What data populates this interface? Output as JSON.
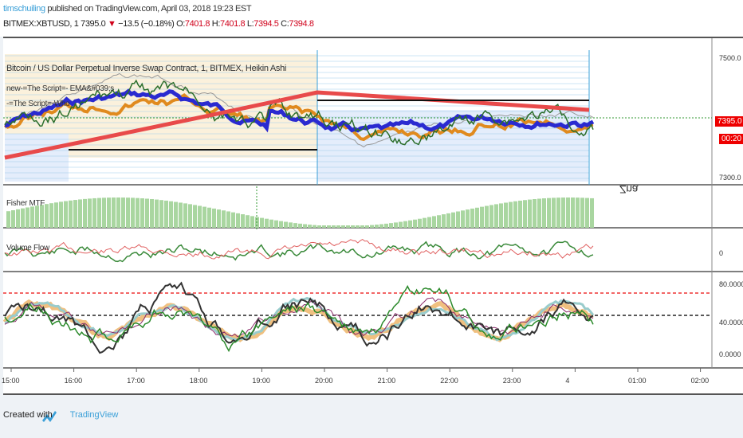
{
  "header": {
    "user": "timschuiling",
    "published": " published on TradingView.com, April 03, 2018 19:23 EST",
    "symbol": "BITMEX:XBTUSD, 1",
    "last": "7395.0",
    "change": "−13.5 (−0.18%)",
    "o_label": "O:",
    "o": "7401.8",
    "h_label": "H:",
    "h": "7401.8",
    "l_label": "L:",
    "l": "7394.5",
    "c_label": "C:",
    "c": "7394.8"
  },
  "main_pane": {
    "title": "Bitcoin / US Dollar Perpetual Inverse Swap Contract, 1, BITMEX, Heikin Ashi",
    "study1": "new-=The Script=- EMA&#039;s",
    "study2": "-=The Script=-Who",
    "price_ticks": [
      "7500.0",
      "7300.0"
    ],
    "price_tag": "7395.0",
    "countdown": "00:20",
    "overlay_text": "Zna"
  },
  "fisher_pane": {
    "title": "Fisher MTF"
  },
  "volume_pane": {
    "title": "Volume Flow",
    "ticks": [
      "0"
    ]
  },
  "osc_pane": {
    "ticks": [
      "80.0000",
      "40.0000",
      "0.0000"
    ]
  },
  "time_axis": [
    "15:00",
    "16:00",
    "17:00",
    "18:00",
    "19:00",
    "20:00",
    "21:00",
    "22:00",
    "23:00",
    "4",
    "01:00",
    "02:00"
  ],
  "footer": {
    "created": "Created with",
    "brand": "TradingView"
  }
}
